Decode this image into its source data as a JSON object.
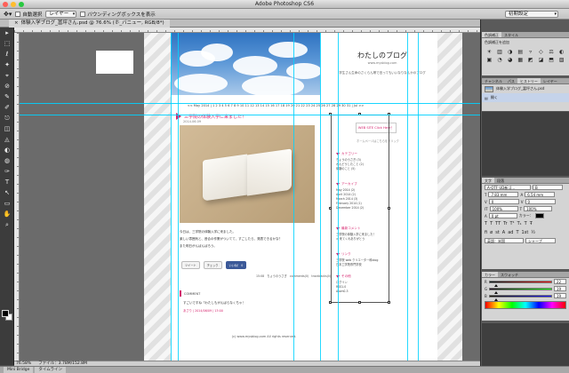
{
  "window": {
    "title": "Adobe Photoshop CS6",
    "traffic_lights": [
      "#ff5f57",
      "#ffbd2e",
      "#28c940"
    ]
  },
  "options_bar": {
    "auto_select_label": "自動選択",
    "auto_select_target": "レイヤー",
    "show_bounds_label": "バウンディングボックスを表示",
    "workspace_preset": "初期設定"
  },
  "document_tab": {
    "label": "体験入学ブログ_冨坪さん.psd @ 76.6% (ホ_バニュー, RGB/8*)"
  },
  "tools": [
    "▸",
    "⬚",
    "ℓ",
    "✦",
    "⌖",
    "⊘",
    "✎",
    "✐",
    "⎋",
    "◫",
    "◬",
    "◐",
    "◍",
    "✑",
    "T",
    "↖",
    "▭",
    "✋",
    "⌕"
  ],
  "blog": {
    "title": "わたしのブログ",
    "url": "www.mysblog.com",
    "description": "学生さん生命のさくらん帯で言ってもいいなりなんかのブログ",
    "calendar": "<< May 2014 | 1 2 3 4 5 6 7 8 9 10 11 12 13 14 15 16 17 18 19 20 21 22 23 24 25 26 27 28 29 30 31 | Jul >>",
    "post": {
      "title": "三学院の体験入学に来ました！",
      "date": "2014.06.09",
      "body": [
        "今日は、三学院の体験入学に来ました。",
        "楽しい雰囲気と、昔合の作業がついてて、すごしたら、発表できるかな？",
        "また明日がんばんばろう。"
      ],
      "share": {
        "tweet": "ツイート",
        "check": "チェック",
        "like": "いいね！ 0"
      },
      "meta": "15:08　ちょうのうさぎ　comments(0)　trackbacks(0)"
    },
    "comments": {
      "heading": "COMMENT",
      "line1": "すごいですね「わたしもがんばらなくちゃ！",
      "line1_sub": "あさり | 2014/06/09 | 13:00"
    },
    "copyright": "(c) www.mysblog.com All rights reserved.",
    "sidebar": {
      "cta": "WEB SITE Click Here！",
      "cta_sub": "ホームページはこちらをクリック",
      "sections": [
        {
          "heading": "カテゴリー",
          "items": [
            "ちょうのうさぎ (3)",
            "かんどうしたこと (2)",
            "体験のこと (5)"
          ]
        },
        {
          "heading": "アーカイブ",
          "items": [
            "May 2014 (2)",
            "April 2014 (2)",
            "March 2014 (3)",
            "February 2014 (1)",
            "December 2014 (2)"
          ]
        },
        {
          "heading": "最新コメント",
          "items": [
            "三学院の体験入学に来ました！",
            "> 来てくれありがとう"
          ]
        },
        {
          "heading": "リンク",
          "items": [
            "三学院 web クリエーター科blog",
            "日本工学院専門学校"
          ]
        },
        {
          "heading": "その他",
          "items": [
            "ログイン",
            "RSS1.0",
            "Atom0.3"
          ]
        }
      ]
    }
  },
  "status_bar": {
    "zoom": "76.58%",
    "file_info": "ファイル：3.78M/152.8M"
  },
  "bottom_tabs": [
    "Mini Bridge",
    "タイムライン"
  ],
  "panels": {
    "adjustments": {
      "tabs": [
        "色調補正",
        "スタイル"
      ],
      "label": "色調補正を追加",
      "icons": [
        "☀",
        "▥",
        "◑",
        "▤",
        "▿",
        "◇",
        "⚖",
        "◐",
        "▣",
        "◔",
        "◕",
        "▦",
        "◩",
        "◪",
        "⬒",
        "▧"
      ]
    },
    "history": {
      "tabs": [
        "チャンネル",
        "パス",
        "ヒストリー",
        "レイヤー"
      ],
      "items": [
        "体験入学ブログ_冨坪さん.psd",
        "開く"
      ]
    },
    "character": {
      "tabs": [
        "文字",
        "段落"
      ],
      "font_family": "A-OTF UD新ゴ...",
      "font_style": "B",
      "font_size": "7.83 mm",
      "leading": "6.54 mm",
      "kerning": "0",
      "tracking": "0",
      "scale_v": "100%",
      "scale_h": "100%",
      "baseline": "0 pt",
      "color_label": "カラー：",
      "glyphs": [
        "T",
        "T",
        "TT",
        "Tr",
        "T¹",
        "T₁",
        "T",
        "Ŧ"
      ],
      "extras": [
        "fi",
        "ø",
        "st",
        "A",
        "ad",
        "T",
        "1st",
        "½"
      ],
      "language": "英語：米国",
      "antialias": "シャープ"
    },
    "color": {
      "tabs": [
        "カラー",
        "スウォッチ"
      ],
      "r": "22",
      "g": "19",
      "b": "19",
      "swatch": "#161313"
    }
  }
}
